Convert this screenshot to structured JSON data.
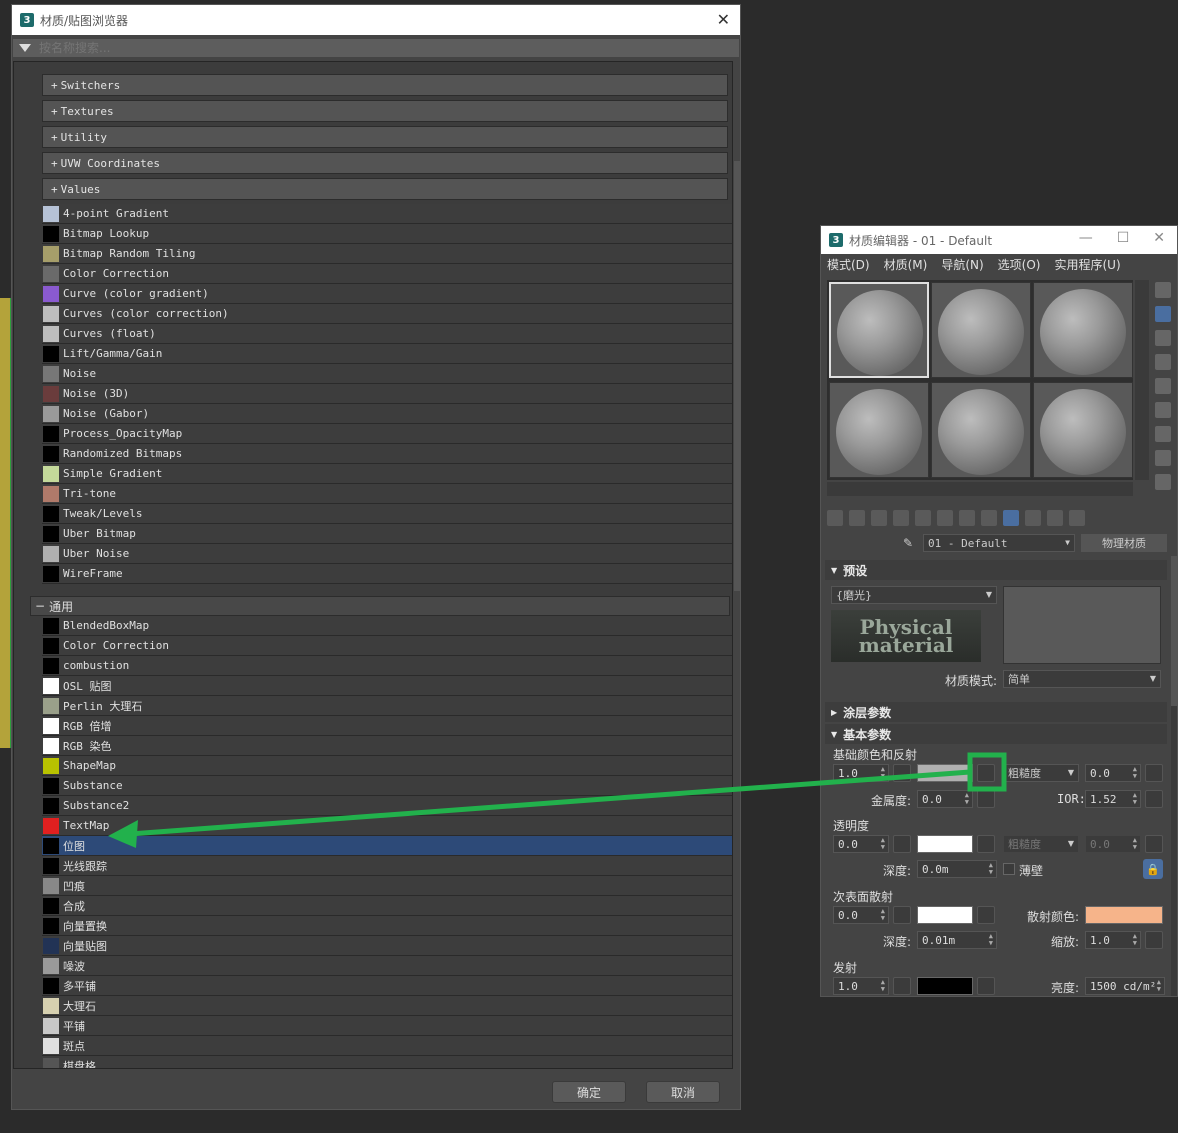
{
  "browser": {
    "title": "材质/贴图浏览器",
    "search_placeholder": "按名称搜索...",
    "categories": [
      "Switchers",
      "Textures",
      "Utility",
      "UVW Coordinates",
      "Values"
    ],
    "items": [
      {
        "label": "4-point Gradient",
        "swatch": "#b6c2d6"
      },
      {
        "label": "Bitmap Lookup",
        "swatch": "#000000"
      },
      {
        "label": "Bitmap Random Tiling",
        "swatch": "#a69e6a"
      },
      {
        "label": "Color Correction",
        "swatch": "#6a6a6a"
      },
      {
        "label": "Curve (color gradient)",
        "swatch": "#8a5ad0"
      },
      {
        "label": "Curves (color correction)",
        "swatch": "#bdbdbd"
      },
      {
        "label": "Curves (float)",
        "swatch": "#bdbdbd"
      },
      {
        "label": "Lift/Gamma/Gain",
        "swatch": "#000000"
      },
      {
        "label": "Noise",
        "swatch": "#777777"
      },
      {
        "label": "Noise (3D)",
        "swatch": "#6a3c3c"
      },
      {
        "label": "Noise (Gabor)",
        "swatch": "#9a9a9a"
      },
      {
        "label": "Process_OpacityMap",
        "swatch": "#000000"
      },
      {
        "label": "Randomized Bitmaps",
        "swatch": "#000000"
      },
      {
        "label": "Simple Gradient",
        "swatch": "#c4d99a"
      },
      {
        "label": "Tri-tone",
        "swatch": "#b07a6a"
      },
      {
        "label": "Tweak/Levels",
        "swatch": "#000000"
      },
      {
        "label": "Uber Bitmap",
        "swatch": "#000000"
      },
      {
        "label": "Uber Noise",
        "swatch": "#b0b0b0"
      },
      {
        "label": "WireFrame",
        "swatch": "#000000"
      }
    ],
    "group_label": "通用",
    "group_items": [
      {
        "label": "BlendedBoxMap",
        "swatch": "#000000"
      },
      {
        "label": "Color Correction",
        "swatch": "#000000"
      },
      {
        "label": "combustion",
        "swatch": "#000000"
      },
      {
        "label": "OSL 贴图",
        "swatch": "#ffffff"
      },
      {
        "label": "Perlin 大理石",
        "swatch": "#9aa08a"
      },
      {
        "label": "RGB 倍增",
        "swatch": "#ffffff"
      },
      {
        "label": "RGB 染色",
        "swatch": "#ffffff"
      },
      {
        "label": "ShapeMap",
        "swatch": "#b8c200"
      },
      {
        "label": "Substance",
        "swatch": "#000000"
      },
      {
        "label": "Substance2",
        "swatch": "#000000"
      },
      {
        "label": "TextMap",
        "swatch": "#e02020"
      },
      {
        "label": "位图",
        "swatch": "#000000"
      },
      {
        "label": "光线跟踪",
        "swatch": "#000000"
      },
      {
        "label": "凹痕",
        "swatch": "#888888"
      },
      {
        "label": "合成",
        "swatch": "#000000"
      },
      {
        "label": "向量置换",
        "swatch": "#000000"
      },
      {
        "label": "向量贴图",
        "swatch": "#223355"
      },
      {
        "label": "噪波",
        "swatch": "#9a9a9a"
      },
      {
        "label": "多平铺",
        "swatch": "#000000"
      },
      {
        "label": "大理石",
        "swatch": "#d6d0b0"
      },
      {
        "label": "平铺",
        "swatch": "#c8c8c8"
      },
      {
        "label": "斑点",
        "swatch": "#e0e0e0"
      },
      {
        "label": "棋盘格",
        "swatch": "#555555"
      }
    ],
    "selected_item": "位图",
    "ok_label": "确定",
    "cancel_label": "取消"
  },
  "editor": {
    "title": "材质编辑器 - 01 - Default",
    "menu": [
      "模式(D)",
      "材质(M)",
      "导航(N)",
      "选项(O)",
      "实用程序(U)"
    ],
    "material_name": "01 - Default",
    "material_type": "物理材质",
    "presets_label": "预设",
    "preset_value": "{磨光}",
    "logo_line1": "Physical",
    "logo_line2": "material",
    "mode_label": "材质模式:",
    "mode_value": "简单",
    "coating_label": "涂层参数",
    "basic_label": "基本参数",
    "base_color_label": "基础颜色和反射",
    "base_weight": "1.0",
    "roughness_label": "粗糙度",
    "roughness_value": "0.0",
    "metalness_label": "金属度:",
    "metalness_value": "0.0",
    "ior_label": "IOR:",
    "ior_value": "1.52",
    "transparency_label": "透明度",
    "transparency_weight": "0.0",
    "trans_roughness_label": "粗糙度",
    "trans_roughness_value": "0.0",
    "depth_label": "深度:",
    "trans_depth_value": "0.0m",
    "thin_label": "薄壁",
    "sss_label": "次表面散射",
    "sss_weight": "0.0",
    "scatter_color_label": "散射颜色:",
    "sss_depth_value": "0.01m",
    "scale_label": "缩放:",
    "scale_value": "1.0",
    "emission_label": "发射",
    "emission_weight": "1.0",
    "luminance_label": "亮度:",
    "luminance_value": "1500 cd/m²",
    "colors": {
      "base": "#b0b0b0",
      "scatter": "#f6b48a",
      "transparency": "#ffffff",
      "sss": "#ffffff",
      "emission": "#000000"
    }
  },
  "annotation_color": "#22b14c"
}
